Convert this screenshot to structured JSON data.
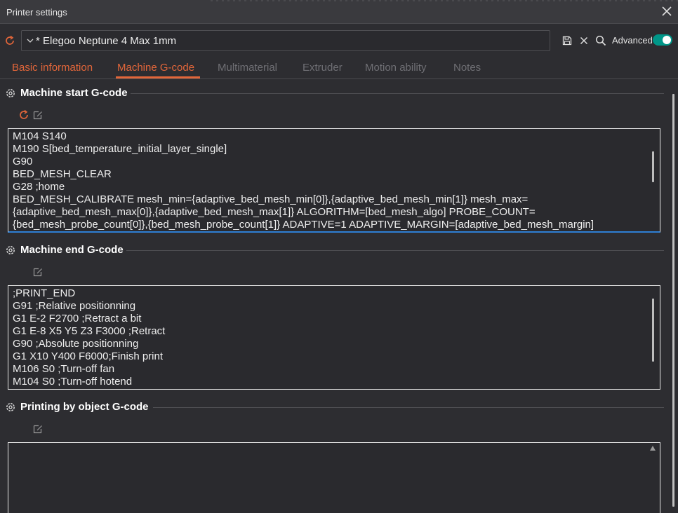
{
  "window": {
    "title": "Printer settings"
  },
  "preset": {
    "name": "* Elegoo Neptune 4 Max 1mm",
    "advanced_label": "Advanced",
    "advanced_on": true
  },
  "tabs": [
    {
      "label": "Basic information",
      "state": "inactive-accent"
    },
    {
      "label": "Machine G-code",
      "state": "active"
    },
    {
      "label": "Multimaterial",
      "state": "inactive"
    },
    {
      "label": "Extruder",
      "state": "inactive"
    },
    {
      "label": "Motion ability",
      "state": "inactive"
    },
    {
      "label": "Notes",
      "state": "inactive"
    }
  ],
  "sections": {
    "start": {
      "title": "Machine start G-code",
      "lines": [
        "M104 S140",
        "M190 S[bed_temperature_initial_layer_single]",
        "G90",
        "BED_MESH_CLEAR",
        "G28 ;home",
        "BED_MESH_CALIBRATE mesh_min={adaptive_bed_mesh_min[0]},{adaptive_bed_mesh_min[1]} mesh_max=",
        "{adaptive_bed_mesh_max[0]},{adaptive_bed_mesh_max[1]} ALGORITHM=[bed_mesh_algo] PROBE_COUNT=",
        "{bed_mesh_probe_count[0]},{bed_mesh_probe_count[1]} ADAPTIVE=1 ADAPTIVE_MARGIN=[adaptive_bed_mesh_margin]"
      ]
    },
    "end": {
      "title": "Machine end G-code",
      "lines": [
        ";PRINT_END",
        "G91 ;Relative positionning",
        "G1 E-2 F2700 ;Retract a bit",
        "G1 E-8 X5 Y5 Z3 F3000 ;Retract",
        "G90 ;Absolute positionning",
        "G1 X10 Y400 F6000;Finish print",
        "M106 S0 ;Turn-off fan",
        "M104 S0 ;Turn-off hotend"
      ]
    },
    "object": {
      "title": "Printing by object G-code",
      "lines": []
    }
  },
  "icons": {
    "close": "close-icon",
    "reset": "reset-icon",
    "save": "save-icon",
    "delete": "x-icon",
    "search": "search-icon",
    "gear": "gear-icon",
    "edit": "edit-icon",
    "chevron": "chevron-down-icon"
  },
  "colors": {
    "accent": "#e2663a",
    "toggle": "#009688",
    "focus": "#2e7fd4"
  }
}
